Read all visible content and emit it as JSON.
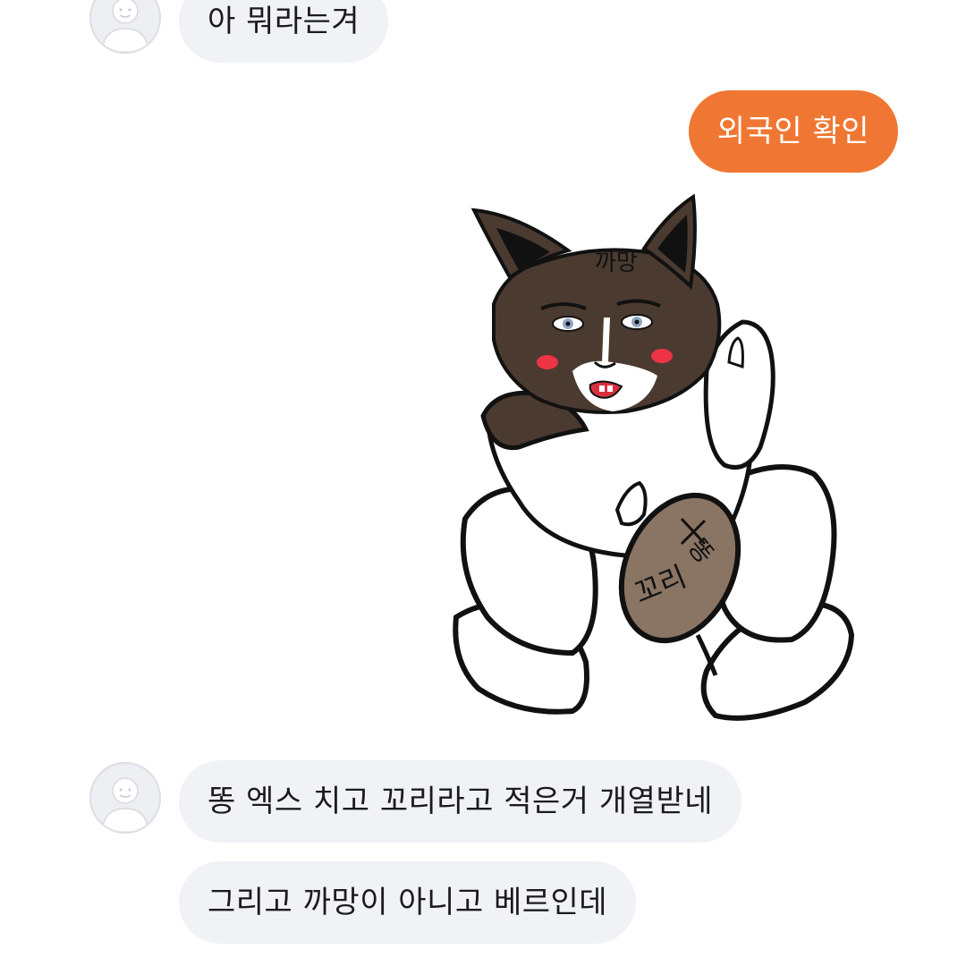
{
  "messages": [
    {
      "side": "incoming",
      "text": "아 뭐라는겨",
      "has_avatar": true
    },
    {
      "side": "outgoing",
      "text": "외국인 확인"
    },
    {
      "side": "outgoing",
      "type": "sticker",
      "sticker": {
        "forehead_text": "까망",
        "tail_text": "똥",
        "tail_text_2": "꼬리"
      }
    },
    {
      "side": "incoming",
      "text": "똥 엑스 치고 꼬리라고 적은거 개열받네",
      "has_avatar": true
    },
    {
      "side": "incoming",
      "text": "그리고 까망이 아니고 베르인데",
      "has_avatar": false
    }
  ],
  "colors": {
    "incoming_bubble": "#f1f2f6",
    "outgoing_bubble": "#f07733",
    "cat_dark": "#4a3a30",
    "cat_light": "#8a7463"
  },
  "icons": [
    "default-avatar-icon"
  ]
}
